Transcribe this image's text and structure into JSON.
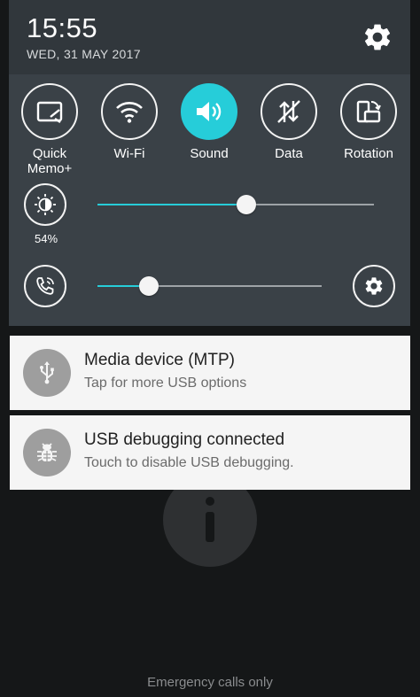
{
  "status": {
    "time": "15:55",
    "date": "WED, 31 MAY 2017"
  },
  "tiles": [
    {
      "label": "Quick\nMemo+",
      "icon": "quick-memo-icon",
      "active": false
    },
    {
      "label": "Wi-Fi",
      "icon": "wifi-icon",
      "active": false
    },
    {
      "label": "Sound",
      "icon": "sound-icon",
      "active": true
    },
    {
      "label": "Data",
      "icon": "data-icon",
      "active": false
    },
    {
      "label": "Rotation",
      "icon": "rotation-icon",
      "active": false
    }
  ],
  "brightness": {
    "percent_label": "54%",
    "level": 0.54
  },
  "volume": {
    "level": 0.23
  },
  "notifications": [
    {
      "title": "Media device (MTP)",
      "subtitle": "Tap for more USB options",
      "icon": "usb-icon"
    },
    {
      "title": "USB debugging connected",
      "subtitle": "Touch to disable USB debugging.",
      "icon": "bug-icon"
    }
  ],
  "lockscreen": {
    "emergency": "Emergency calls only"
  },
  "colors": {
    "accent": "#26cdd9",
    "panel": "#3a4147",
    "header": "#31373c",
    "card": "#f5f5f5"
  }
}
